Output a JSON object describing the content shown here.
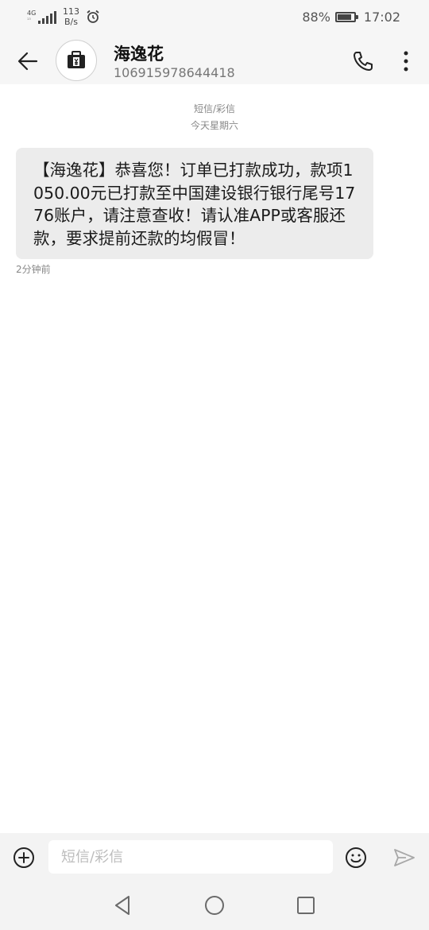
{
  "status_bar": {
    "network_type": "4G",
    "network_sub": "¹³",
    "speed_value": "113",
    "speed_unit": "B/s",
    "battery_percent": "88%",
    "battery_level": 0.88,
    "time": "17:02"
  },
  "header": {
    "contact_name": "海逸花",
    "contact_number": "106915978644418",
    "avatar_icon": "contact-card-icon",
    "back_icon": "arrow-left-icon",
    "call_icon": "phone-icon",
    "more_icon": "more-vertical-icon"
  },
  "conversation": {
    "message_type": "短信/彩信",
    "date_label": "今天星期六",
    "messages": [
      {
        "text": "【海逸花】恭喜您！订单已打款成功，款项1050.00元已打款至中国建设银行银行尾号1776账户，请注意查收！请认准APP或客服还款，要求提前还款的均假冒！",
        "time": "2分钟前"
      }
    ]
  },
  "input_bar": {
    "placeholder": "短信/彩信",
    "value": ""
  },
  "colors": {
    "bar_bg": "#f6f6f6",
    "bubble_bg": "#ececec",
    "meta_text": "#888888"
  }
}
